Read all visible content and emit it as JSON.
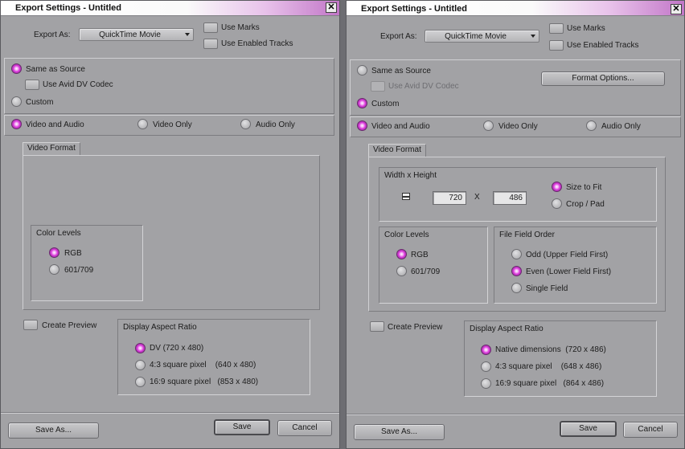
{
  "dialog_title": "Export Settings - Untitled",
  "close_glyph": "✕",
  "export_as_label": "Export As:",
  "export_as_value": "QuickTime Movie",
  "use_marks": "Use Marks",
  "use_enabled_tracks": "Use Enabled Tracks",
  "same_as_source": "Same as Source",
  "use_avid_dv_codec": "Use Avid DV Codec",
  "custom": "Custom",
  "format_options": "Format Options...",
  "video_and_audio": "Video and Audio",
  "video_only": "Video Only",
  "audio_only": "Audio Only",
  "video_format_tab": "Video Format",
  "width_height_title": "Width x Height",
  "width_value": "720",
  "x_sep": "X",
  "height_value": "486",
  "size_to_fit": "Size to Fit",
  "crop_pad": "Crop / Pad",
  "color_levels_title": "Color Levels",
  "rgb": "RGB",
  "ccir": "601/709",
  "file_field_order_title": "File Field Order",
  "odd_field": "Odd (Upper Field First)",
  "even_field": "Even (Lower Field First)",
  "single_field": "Single Field",
  "create_preview": "Create Preview",
  "display_aspect_ratio_title": "Display Aspect Ratio",
  "left_aspect": [
    "DV  (720 x 480)",
    "4:3 square pixel    (640 x 480)",
    "16:9 square pixel   (853 x 480)"
  ],
  "right_aspect": [
    "Native dimensions  (720 x 486)",
    "4:3 square pixel    (648 x 486)",
    "16:9 square pixel   (864 x 486)"
  ],
  "save_as": "Save As...",
  "save": "Save",
  "cancel": "Cancel",
  "colors": {
    "accent_magenta": "#d832d8",
    "dialog_bg": "#a2a2a5"
  },
  "icons": {
    "close": "close-icon",
    "dropdown": "chevron-down-icon",
    "lock": "lock-icon"
  }
}
